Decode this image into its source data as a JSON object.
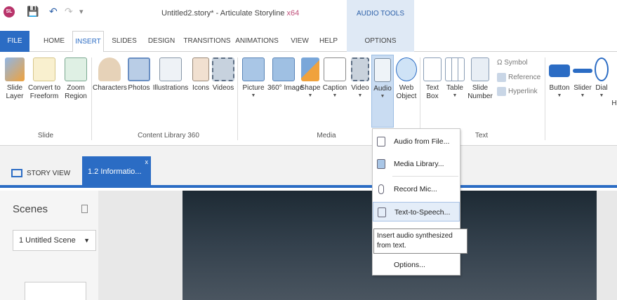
{
  "titlebar": {
    "app_badge": "SL",
    "title_main": "Untitled2.story* - Articulate Storyline",
    "title_suffix": "x64",
    "contextual_header": "AUDIO TOOLS"
  },
  "tabs": [
    "FILE",
    "HOME",
    "INSERT",
    "SLIDES",
    "DESIGN",
    "TRANSITIONS",
    "ANIMATIONS",
    "VIEW",
    "HELP",
    "OPTIONS"
  ],
  "ribbon": {
    "slide_group": {
      "label": "Slide",
      "buttons": [
        [
          "Slide",
          "Layer"
        ],
        [
          "Convert to",
          "Freeform"
        ],
        [
          "Zoom",
          "Region"
        ]
      ]
    },
    "content_group": {
      "label": "Content Library 360",
      "buttons": [
        "Characters",
        "Photos",
        "Illustrations",
        "Icons",
        "Videos"
      ]
    },
    "media_group": {
      "label": "Media",
      "buttons": [
        "Picture",
        "360° Image",
        "Shape",
        "Caption",
        "Video",
        "Audio",
        [
          "Web",
          "Object"
        ]
      ]
    },
    "text_group": {
      "label": "Text",
      "buttons": [
        [
          "Text",
          "Box"
        ],
        [
          "Table",
          ""
        ],
        [
          "Slide",
          "Number"
        ]
      ],
      "small": [
        "Symbol",
        "Reference",
        "Hyperlink"
      ]
    },
    "interactive": [
      "Button",
      "Slider",
      "Dial",
      "H"
    ]
  },
  "story": {
    "story_view": "STORY VIEW",
    "slide_tab": "1.2 Informatio...",
    "close": "x"
  },
  "scenes": {
    "title": "Scenes",
    "selected": "1 Untitled Scene"
  },
  "audio_menu": {
    "items": [
      "Audio from File...",
      "Media Library...",
      "Record Mic...",
      "Text-to-Speech...",
      "Options..."
    ],
    "tooltip": "Insert audio synthesized from text."
  },
  "colors": {
    "accent": "#2b6cc4",
    "contextual": "#dfe9f5"
  }
}
